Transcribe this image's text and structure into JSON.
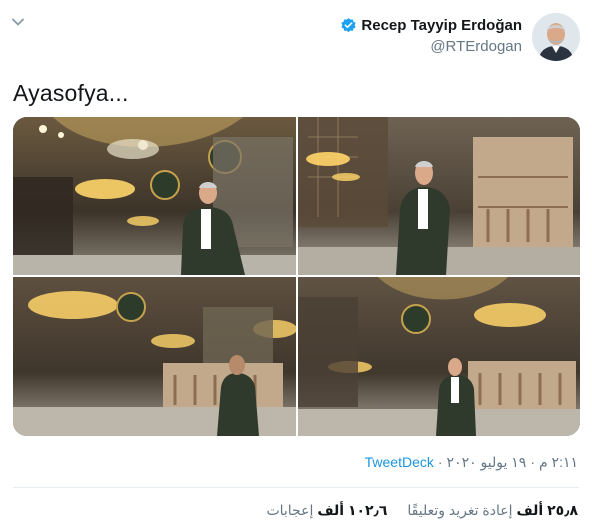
{
  "author": {
    "display_name": "Recep Tayyip Erdoğan",
    "handle": "@RTErdogan",
    "verified": true,
    "avatar_icon": "profile-photo"
  },
  "tweet": {
    "text": "Ayasofya...",
    "photos": [
      {
        "label": "Ayasofya interior photo 1"
      },
      {
        "label": "Ayasofya interior photo 2"
      },
      {
        "label": "Ayasofya interior photo 3"
      },
      {
        "label": "Ayasofya interior photo 4"
      }
    ]
  },
  "meta": {
    "time": "٢:١١ م",
    "separator": "·",
    "date": "١٩ يوليو ٢٠٢٠",
    "separator2": "·",
    "source": "TweetDeck"
  },
  "stats": {
    "retweets_count": "٢٥٫٨ ألف",
    "retweets_label": "إعادة تغريد وتعليقًا",
    "likes_count": "١٠٢٫٦ ألف",
    "likes_label": "إعجابات"
  },
  "colors": {
    "link": "#1b95e0",
    "verified": "#1da1f2",
    "secondary_text": "#657786"
  }
}
